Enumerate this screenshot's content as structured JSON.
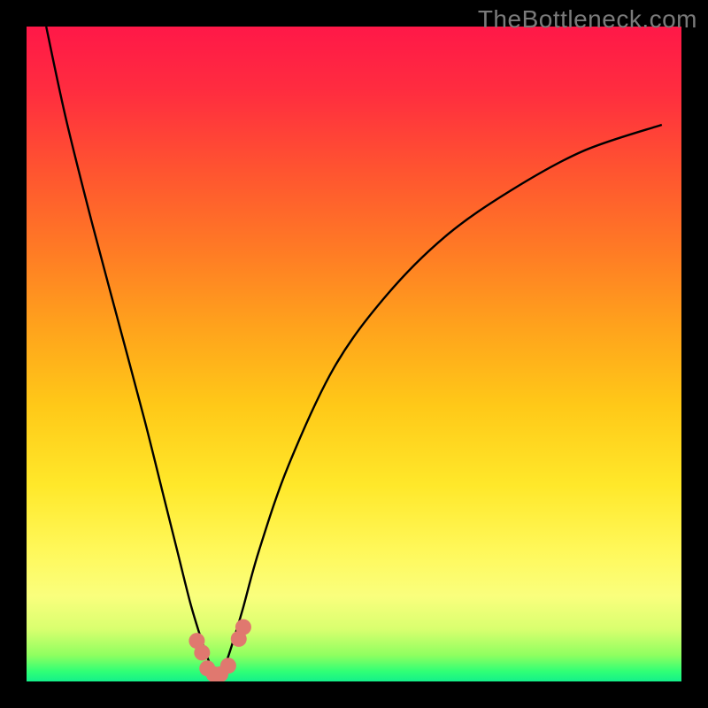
{
  "watermark": "TheBottleneck.com",
  "colors": {
    "gradient_top": "#ff1848",
    "gradient_mid": "#ffe82a",
    "gradient_bottom": "#14f08a",
    "frame": "#000000",
    "curve": "#000000",
    "dot": "#e0786f"
  },
  "chart_data": {
    "type": "line",
    "title": "",
    "xlabel": "",
    "ylabel": "",
    "xlim": [
      0,
      100
    ],
    "ylim": [
      0,
      100
    ],
    "grid": false,
    "legend": false,
    "series": [
      {
        "name": "bottleneck-curve",
        "x": [
          3,
          6,
          10,
          14,
          18,
          21,
          23,
          25,
          26.5,
          27.5,
          28.3,
          29,
          29.7,
          30.5,
          31.5,
          33,
          35.5,
          40,
          47,
          55,
          64,
          74,
          85,
          97
        ],
        "y": [
          100,
          86,
          70,
          55,
          40,
          28,
          20,
          12,
          7,
          4,
          2,
          1,
          1.5,
          3,
          6,
          11,
          20,
          33,
          48,
          59,
          68,
          75,
          81,
          85
        ]
      }
    ],
    "markers": [
      {
        "x": 26.0,
        "y": 6.2
      },
      {
        "x": 26.8,
        "y": 4.4
      },
      {
        "x": 27.6,
        "y": 2.0
      },
      {
        "x": 28.6,
        "y": 1.1
      },
      {
        "x": 29.6,
        "y": 1.1
      },
      {
        "x": 30.8,
        "y": 2.4
      },
      {
        "x": 32.4,
        "y": 6.5
      },
      {
        "x": 33.1,
        "y": 8.3
      }
    ]
  }
}
